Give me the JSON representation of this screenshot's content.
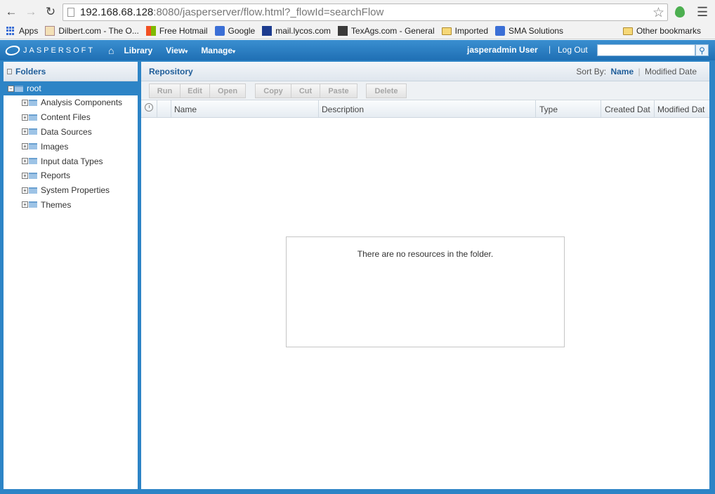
{
  "browser": {
    "url_host": "192.168.68.128",
    "url_rest": ":8080/jasperserver/flow.html?_flowId=searchFlow",
    "bookmarks": [
      {
        "label": "Apps"
      },
      {
        "label": "Dilbert.com - The O..."
      },
      {
        "label": "Free Hotmail"
      },
      {
        "label": "Google"
      },
      {
        "label": "mail.lycos.com"
      },
      {
        "label": "TexAgs.com - General"
      },
      {
        "label": "Imported"
      },
      {
        "label": "SMA Solutions"
      }
    ],
    "other_bookmarks": "Other bookmarks"
  },
  "app": {
    "logo_text": "JASPERSOFT",
    "menu": {
      "library": "Library",
      "view": "View",
      "manage": "Manage"
    },
    "user": "jasperadmin User",
    "logout": "Log Out",
    "search_value": ""
  },
  "folders": {
    "title": "Folders",
    "root": "root",
    "items": [
      "Analysis Components",
      "Content Files",
      "Data Sources",
      "Images",
      "Input data Types",
      "Reports",
      "System Properties",
      "Themes"
    ]
  },
  "repository": {
    "title": "Repository",
    "sort_by": "Sort By:",
    "sort_name": "Name",
    "sort_modified": "Modified Date",
    "toolbar": {
      "run": "Run",
      "edit": "Edit",
      "open": "Open",
      "copy": "Copy",
      "cut": "Cut",
      "paste": "Paste",
      "delete": "Delete"
    },
    "columns": {
      "name": "Name",
      "description": "Description",
      "type": "Type",
      "created": "Created Dat",
      "modified": "Modified Dat"
    },
    "empty_message": "There are no resources in the folder."
  },
  "colors": {
    "brand_blue": "#2d84c6",
    "header_text": "#1f5d99"
  }
}
